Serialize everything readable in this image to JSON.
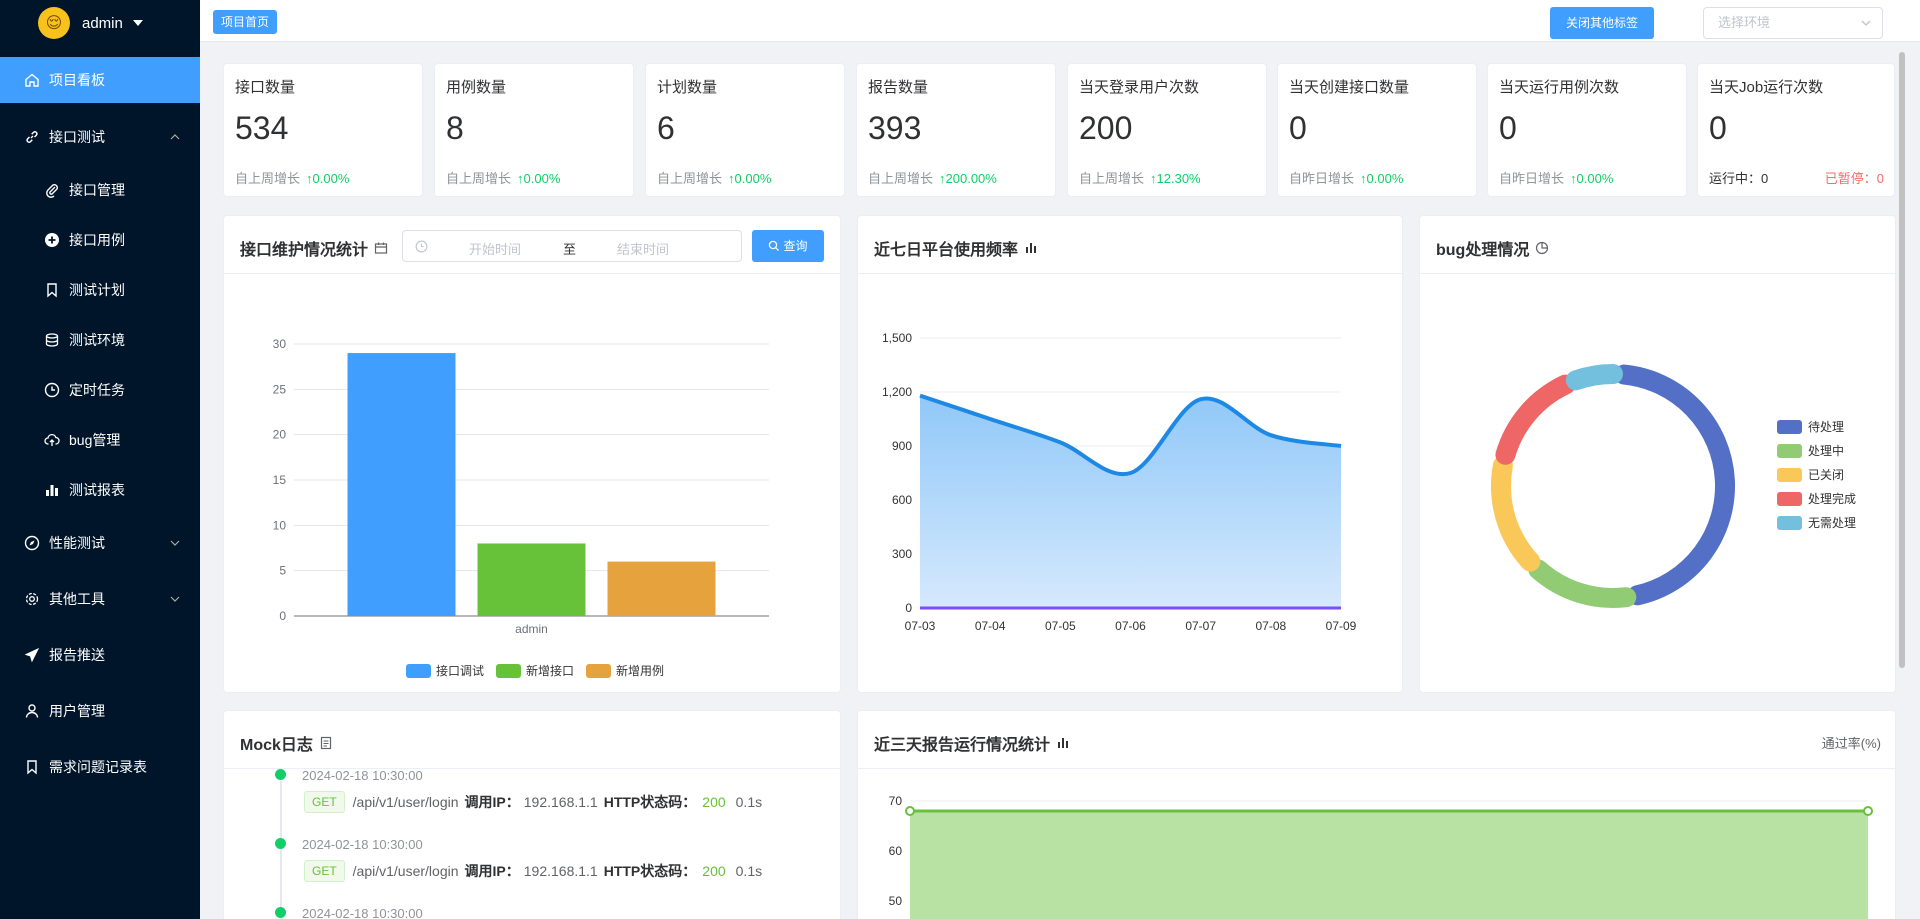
{
  "user": {
    "name": "admin",
    "avatar_icon": "emoji-face-icon"
  },
  "sidebar": {
    "items": [
      {
        "label": "项目看板",
        "icon": "home-icon",
        "active": true
      },
      {
        "label": "接口测试",
        "icon": "link-icon",
        "expanded": true
      },
      {
        "label": "接口管理",
        "icon": "paperclip-icon"
      },
      {
        "label": "接口用例",
        "icon": "plus-circle-icon"
      },
      {
        "label": "测试计划",
        "icon": "bookmark-icon"
      },
      {
        "label": "测试环境",
        "icon": "database-icon"
      },
      {
        "label": "定时任务",
        "icon": "clock-icon"
      },
      {
        "label": "bug管理",
        "icon": "cloud-upload-icon"
      },
      {
        "label": "测试报表",
        "icon": "bar-chart-icon"
      },
      {
        "label": "性能测试",
        "icon": "compass-icon"
      },
      {
        "label": "其他工具",
        "icon": "settings-icon"
      },
      {
        "label": "报告推送",
        "icon": "send-icon"
      },
      {
        "label": "用户管理",
        "icon": "user-icon"
      },
      {
        "label": "需求问题记录表",
        "icon": "bookmark-icon"
      }
    ]
  },
  "header": {
    "home_tag": "项目首页",
    "close_tags_button": "关闭其他标签",
    "env_placeholder": "选择环境"
  },
  "stats": [
    {
      "title": "接口数量",
      "value": "534",
      "foot_label": "自上周增长",
      "rate": "0.00%"
    },
    {
      "title": "用例数量",
      "value": "8",
      "foot_label": "自上周增长",
      "rate": "0.00%"
    },
    {
      "title": "计划数量",
      "value": "6",
      "foot_label": "自上周增长",
      "rate": "0.00%"
    },
    {
      "title": "报告数量",
      "value": "393",
      "foot_label": "自上周增长",
      "rate": "200.00%"
    },
    {
      "title": "当天登录用户次数",
      "value": "200",
      "foot_label": "自上周增长",
      "rate": "12.30%"
    },
    {
      "title": "当天创建接口数量",
      "value": "0",
      "foot_label": "自昨日增长",
      "rate": "0.00%"
    },
    {
      "title": "当天运行用例次数",
      "value": "0",
      "foot_label": "自昨日增长",
      "rate": "0.00%"
    },
    {
      "title": "当天Job运行次数",
      "value": "0",
      "foot_label": "运行中：0",
      "rate": "",
      "foot_right": "已暂停：0"
    }
  ],
  "panels": {
    "interface_stats": {
      "title": "接口维护情况统计",
      "start_placeholder": "开始时间",
      "separator": "至",
      "end_placeholder": "结束时间",
      "query_button": "查询"
    },
    "usage": {
      "title": "近七日平台使用频率"
    },
    "bugs": {
      "title": "bug处理情况"
    },
    "mock": {
      "title": "Mock日志"
    },
    "reports": {
      "title": "近三天报告运行情况统计",
      "right_label": "通过率(%)"
    }
  },
  "mock_logs": [
    {
      "time": "2024-02-18 10:30:00",
      "method": "GET",
      "path": "/api/v1/user/login",
      "ip_label": "调用IP：",
      "ip": "192.168.1.1",
      "status_label": "HTTP状态码：",
      "status": "200",
      "duration": "0.1s"
    },
    {
      "time": "2024-02-18 10:30:00",
      "method": "GET",
      "path": "/api/v1/user/login",
      "ip_label": "调用IP：",
      "ip": "192.168.1.1",
      "status_label": "HTTP状态码：",
      "status": "200",
      "duration": "0.1s"
    },
    {
      "time": "2024-02-18 10:30:00"
    }
  ],
  "chart_data": [
    {
      "type": "bar",
      "categories": [
        "admin"
      ],
      "series": [
        {
          "name": "接口调试",
          "values": [
            29
          ],
          "color": "#409eff"
        },
        {
          "name": "新增接口",
          "values": [
            8
          ],
          "color": "#67c23a"
        },
        {
          "name": "新增用例",
          "values": [
            6
          ],
          "color": "#e6a23c"
        }
      ],
      "ylim": [
        0,
        30
      ],
      "yticks": [
        "0",
        "5",
        "10",
        "15",
        "20",
        "25",
        "30"
      ],
      "legend": "bottom"
    },
    {
      "type": "area",
      "x": [
        "07-03",
        "07-04",
        "07-05",
        "07-06",
        "07-07",
        "07-08",
        "07-09"
      ],
      "series": [
        {
          "values": [
            1180,
            1050,
            920,
            750,
            1160,
            960,
            900
          ],
          "color": "#1e88e5"
        },
        {
          "values": [
            0,
            0,
            0,
            0,
            0,
            0,
            0
          ],
          "color": "#7c4dff"
        }
      ],
      "ylim": [
        0,
        1500
      ],
      "yticks": [
        "0",
        "300",
        "600",
        "900",
        "1,200",
        "1,500"
      ]
    },
    {
      "type": "pie",
      "style": "donut",
      "slices": [
        {
          "name": "待处理",
          "value": 40,
          "color": "#5470c6"
        },
        {
          "name": "处理中",
          "value": 13,
          "color": "#91cc75"
        },
        {
          "name": "已关闭",
          "value": 14,
          "color": "#fac858"
        },
        {
          "name": "处理完成",
          "value": 13,
          "color": "#ee6666"
        },
        {
          "name": "无需处理",
          "value": 6,
          "color": "#73c0de"
        }
      ],
      "legend": "right"
    },
    {
      "type": "area",
      "series": [
        {
          "values": [
            68,
            68
          ],
          "color": "#67c23a"
        }
      ],
      "ylim": [
        50,
        70
      ],
      "yticks": [
        "50",
        "60",
        "70"
      ],
      "ylabel": "通过率(%)"
    }
  ]
}
